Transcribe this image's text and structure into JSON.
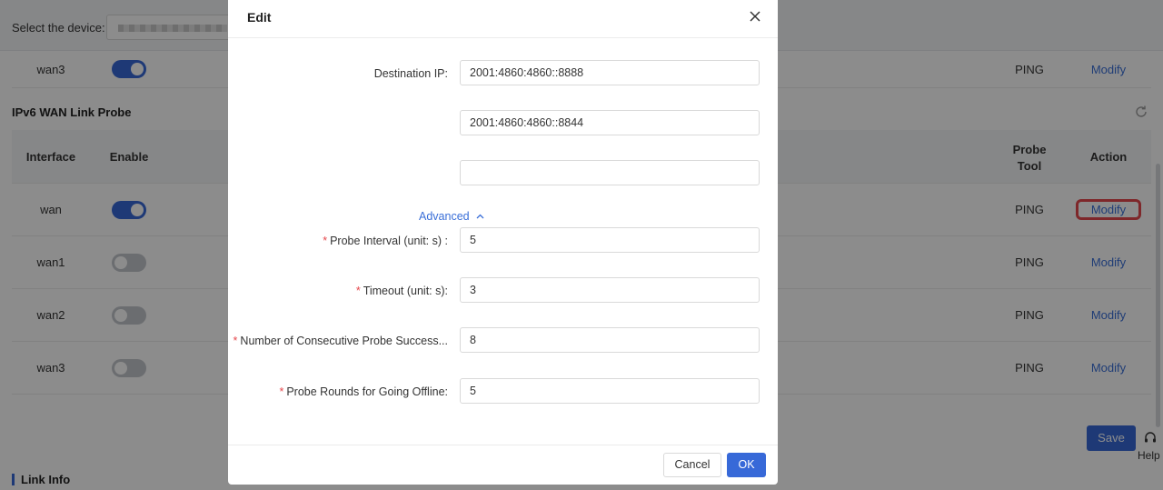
{
  "background": {
    "device_label": "Select the device:",
    "top_row": {
      "interface": "wan3",
      "tool": "PING",
      "action": "Modify"
    },
    "section_title": "IPv6 WAN Link Probe",
    "columns": {
      "interface": "Interface",
      "enable": "Enable",
      "probe_tool": "Probe Tool",
      "action": "Action"
    },
    "rows": [
      {
        "interface": "wan",
        "enabled": true,
        "tool": "PING",
        "action": "Modify"
      },
      {
        "interface": "wan1",
        "enabled": false,
        "tool": "PING",
        "action": "Modify"
      },
      {
        "interface": "wan2",
        "enabled": false,
        "tool": "PING",
        "action": "Modify"
      },
      {
        "interface": "wan3",
        "enabled": false,
        "tool": "PING",
        "action": "Modify"
      }
    ],
    "save_label": "Save",
    "help_label": "Help",
    "link_info_title": "Link Info"
  },
  "modal": {
    "title": "Edit",
    "destination_label": "Destination IP:",
    "destination_ips": [
      "2001:4860:4860::8888",
      "2001:4860:4860::8844",
      ""
    ],
    "advanced_label": "Advanced",
    "fields": [
      {
        "label": "Probe Interval (unit: s) :",
        "value": "5"
      },
      {
        "label": "Timeout (unit: s):",
        "value": "3"
      },
      {
        "label": "Number of Consecutive Probe Success...",
        "value": "8"
      },
      {
        "label": "Probe Rounds for Going Offline:",
        "value": "5"
      }
    ],
    "cancel_label": "Cancel",
    "ok_label": "OK"
  },
  "colors": {
    "primary": "#3769d8",
    "required": "#e5484d",
    "link": "#3a6fd8"
  }
}
